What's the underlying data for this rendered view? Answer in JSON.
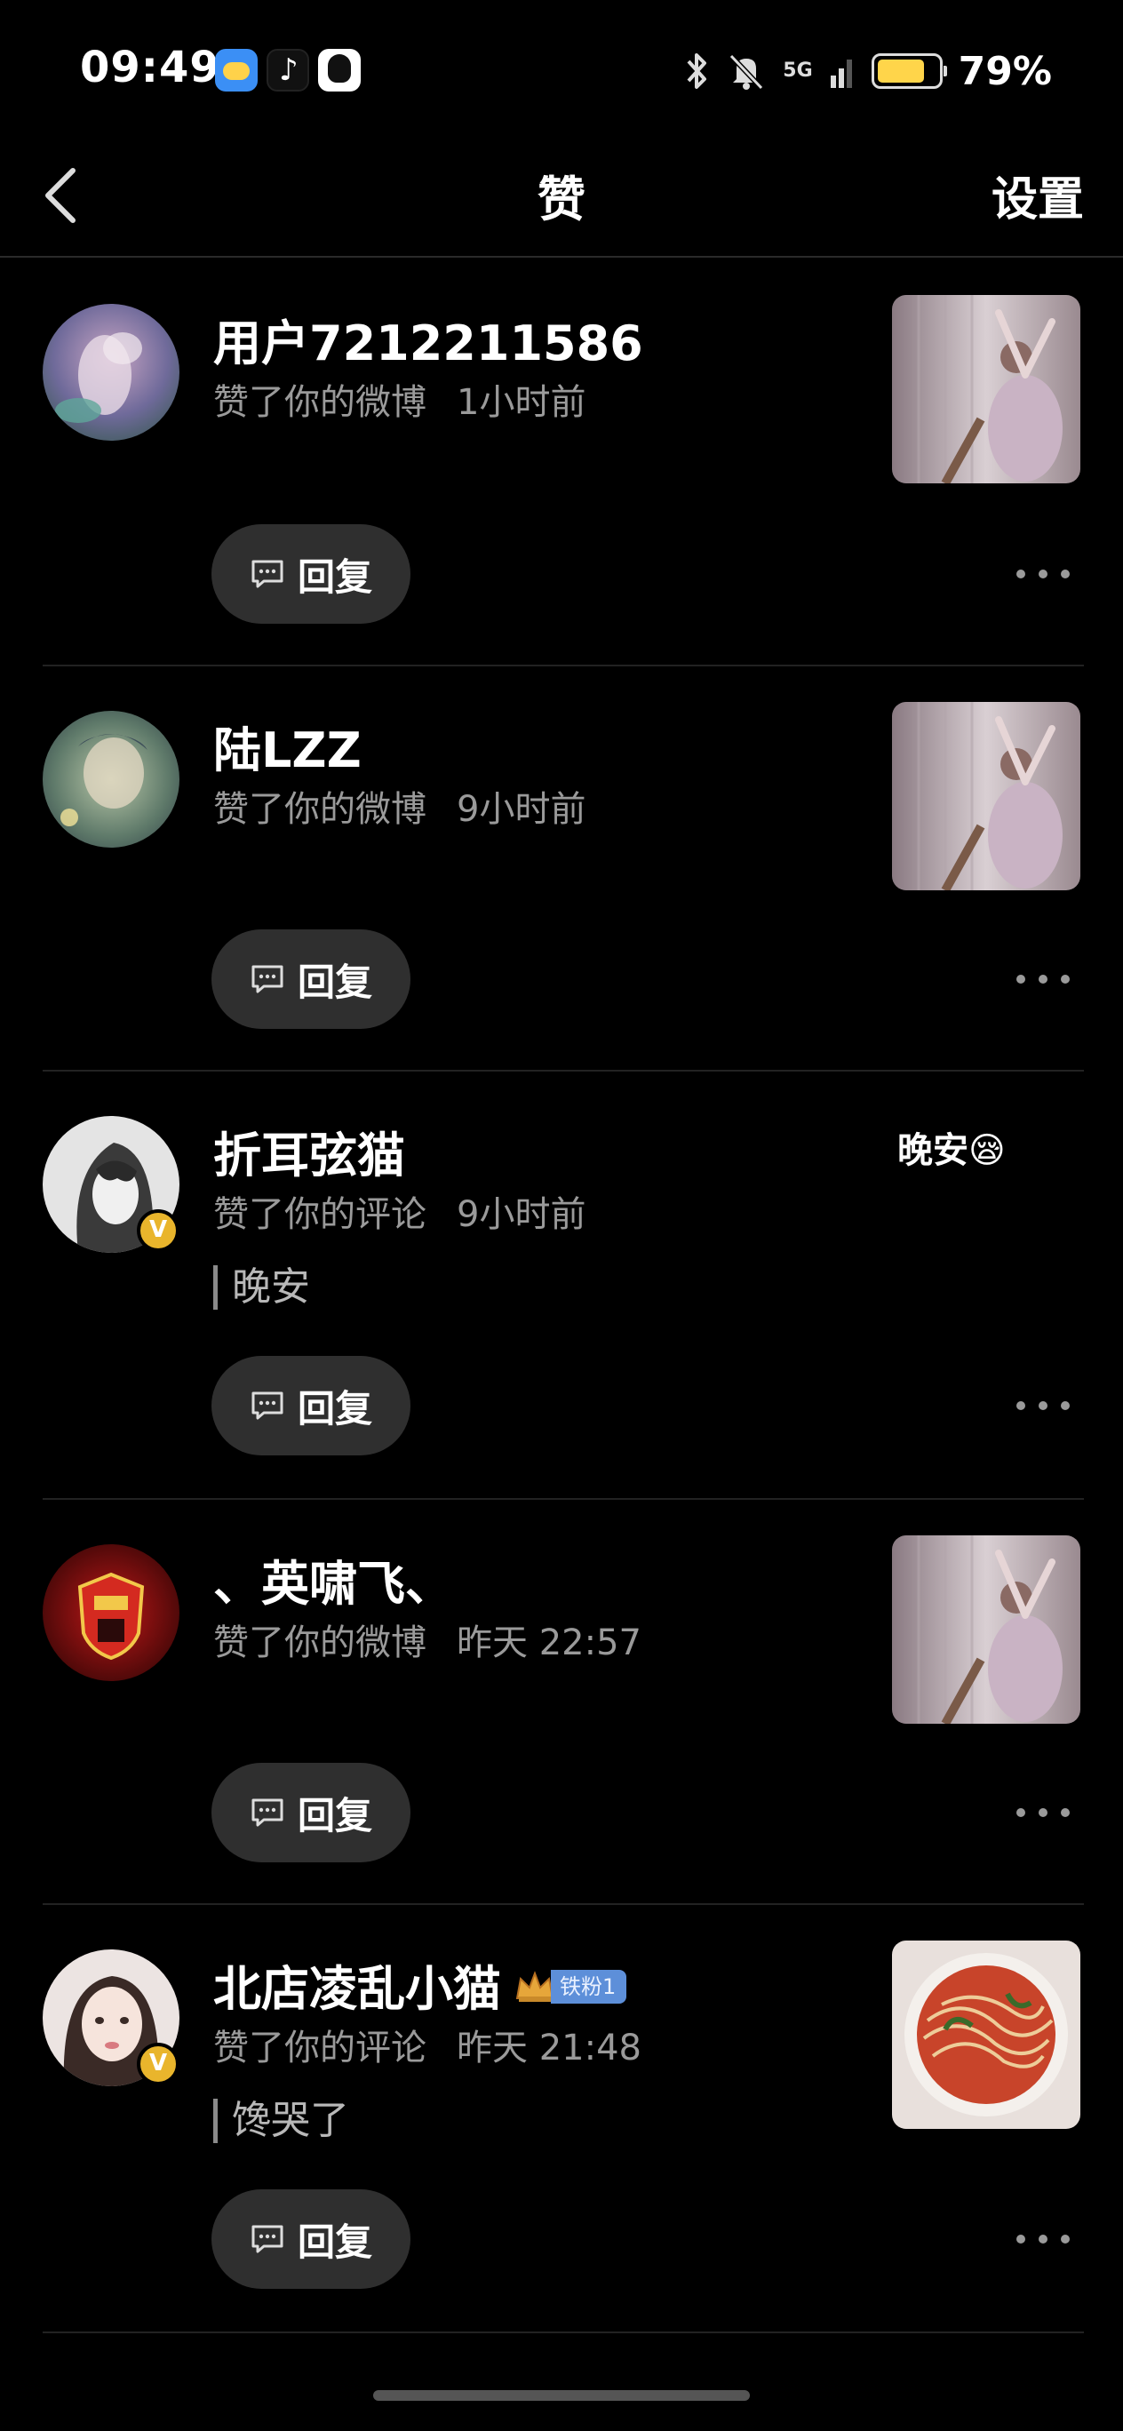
{
  "status_bar": {
    "time": "09:49",
    "network": "5G",
    "battery_percent": "79%",
    "battery_level": 0.79,
    "icons": [
      "weather-icon",
      "tiktok-icon",
      "qq-icon",
      "bluetooth-icon",
      "mute-icon",
      "signal-icon",
      "battery-icon"
    ]
  },
  "nav": {
    "title": "赞",
    "settings_label": "设置"
  },
  "reply_label": "回复",
  "items": [
    {
      "name": "用户7212211586",
      "action": "赞了你的微博",
      "time": "1小时前",
      "thumb": "dancer-photo"
    },
    {
      "name": "陆LZZ",
      "action": "赞了你的微博",
      "time": "9小时前",
      "thumb": "dancer-photo"
    },
    {
      "name": "折耳弦猫",
      "action": "赞了你的评论",
      "time": "9小时前",
      "quote": "晚安",
      "thumb_text": "晚安😪",
      "verified": true
    },
    {
      "name": "、英啸飞、",
      "action": "赞了你的微博",
      "time": "昨天 22:57",
      "thumb": "dancer-photo"
    },
    {
      "name": "北店凌乱小猫",
      "fan_badge": "铁粉1",
      "action": "赞了你的评论",
      "time": "昨天 21:48",
      "quote": "馋哭了",
      "thumb": "noodle-photo",
      "verified": true
    }
  ]
}
